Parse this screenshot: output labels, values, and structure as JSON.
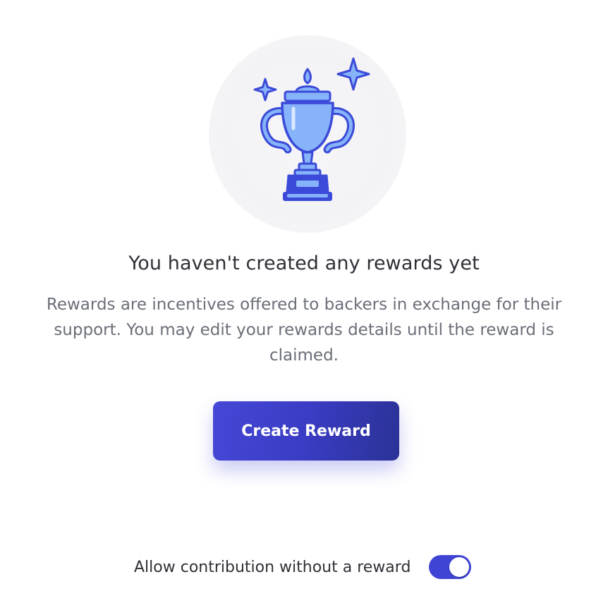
{
  "empty_state": {
    "illustration_icon": "trophy-with-sparkles-icon",
    "heading": "You haven't created any rewards yet",
    "description": "Rewards are incentives offered to backers in exchange for their support. You may edit your rewards details until the reward is claimed."
  },
  "actions": {
    "create_reward_label": "Create Reward"
  },
  "settings": {
    "allow_contribution_label": "Allow contribution without a reward",
    "allow_contribution_enabled": true
  },
  "colors": {
    "accent": "#4044d4",
    "trophy_fill": "#86b3f9",
    "trophy_stroke": "#3b4ad8"
  }
}
